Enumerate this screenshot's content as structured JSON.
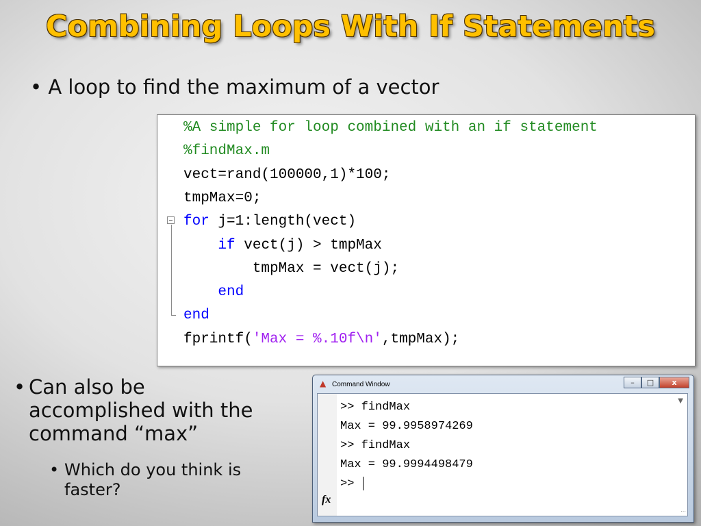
{
  "slide": {
    "title": "Combining Loops With If Statements",
    "bullet1": "A loop to find the maximum of a vector",
    "bullet2_lines": [
      "Can also be",
      "accomplished with the",
      "command “max”"
    ],
    "sub_bullet_lines": [
      "Which do you think is",
      "faster?"
    ],
    "bullet_glyph": "•"
  },
  "code": {
    "lines": [
      {
        "parts": [
          {
            "t": "%A simple for loop combined with an if statement",
            "c": "cmt"
          }
        ]
      },
      {
        "parts": [
          {
            "t": "%findMax.m",
            "c": "cmt"
          }
        ]
      },
      {
        "parts": [
          {
            "t": "vect=rand(100000,1)*100;",
            "c": ""
          }
        ]
      },
      {
        "parts": [
          {
            "t": "tmpMax=0;",
            "c": ""
          }
        ]
      },
      {
        "parts": [
          {
            "t": "for",
            "c": "kw"
          },
          {
            "t": " j=1:length(vect)",
            "c": ""
          }
        ]
      },
      {
        "parts": [
          {
            "t": "    ",
            "c": ""
          },
          {
            "t": "if",
            "c": "kw"
          },
          {
            "t": " vect(j) > tmpMax",
            "c": ""
          }
        ]
      },
      {
        "parts": [
          {
            "t": "        tmpMax = vect(j);",
            "c": ""
          }
        ]
      },
      {
        "parts": [
          {
            "t": "    ",
            "c": ""
          },
          {
            "t": "end",
            "c": "kw"
          }
        ]
      },
      {
        "parts": [
          {
            "t": "end",
            "c": "kw"
          }
        ]
      },
      {
        "parts": [
          {
            "t": "fprintf(",
            "c": ""
          },
          {
            "t": "'Max = %.10f\\n'",
            "c": "str"
          },
          {
            "t": ",tmpMax);",
            "c": ""
          }
        ]
      }
    ]
  },
  "command_window": {
    "title": "Command Window",
    "buttons": {
      "minimize": "–",
      "maximize": "□",
      "close": "x"
    },
    "lines": [
      ">> findMax",
      "Max = 99.9958974269",
      ">> findMax",
      "Max = 99.9994498479",
      ">> "
    ],
    "fx_label": "fx",
    "icons": {
      "logo": "matlab-logo-icon",
      "scroll": "dropdown-icon",
      "fx": "function-icon"
    }
  }
}
